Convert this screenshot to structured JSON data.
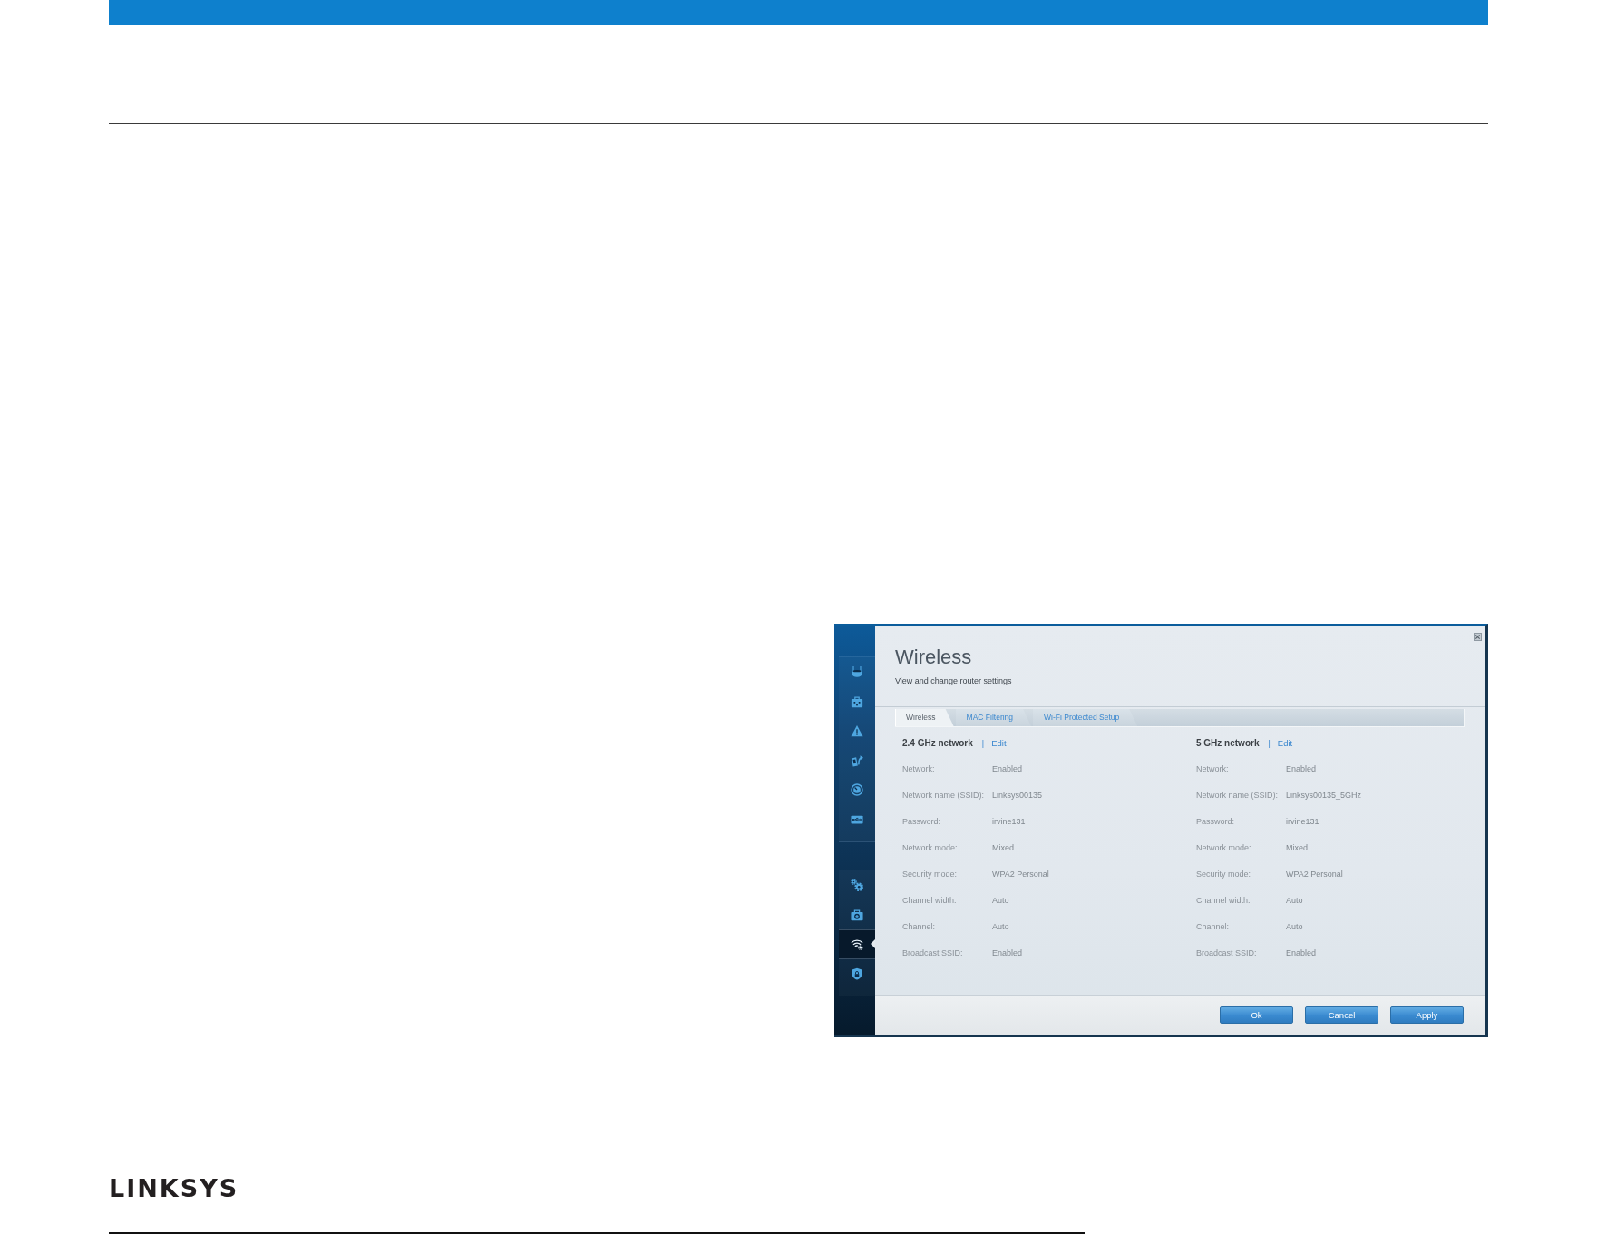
{
  "screenshot": {
    "sidebar": {
      "groups": [
        {
          "items": [
            {
              "kind": "router",
              "selected": false
            },
            {
              "kind": "devices",
              "selected": false
            },
            {
              "kind": "alert",
              "selected": false
            },
            {
              "kind": "parental",
              "selected": false
            },
            {
              "kind": "speed",
              "selected": false
            },
            {
              "kind": "storage",
              "selected": false
            }
          ]
        },
        {
          "items": [
            {
              "kind": "connectivity",
              "selected": false
            },
            {
              "kind": "troubleshooting",
              "selected": false
            },
            {
              "kind": "wireless",
              "selected": true
            },
            {
              "kind": "security",
              "selected": false
            }
          ]
        }
      ]
    },
    "panel": {
      "title": "Wireless",
      "subtitle": "View and change router settings",
      "tabs": [
        {
          "label": "Wireless",
          "selected": true
        },
        {
          "label": "MAC Filtering",
          "selected": false
        },
        {
          "label": "Wi-Fi Protected Setup",
          "selected": false
        }
      ],
      "networks": [
        {
          "heading": "2.4 GHz network",
          "separator": "|",
          "link": "Edit",
          "rows": [
            {
              "label": "Network:",
              "value": "Enabled"
            },
            {
              "label": "Network name (SSID):",
              "value": "Linksys00135"
            },
            {
              "label": "Password:",
              "value": "irvine131"
            },
            {
              "label": "Network mode:",
              "value": "Mixed"
            },
            {
              "label": "Security mode:",
              "value": "WPA2 Personal"
            },
            {
              "label": "Channel width:",
              "value": "Auto"
            },
            {
              "label": "Channel:",
              "value": "Auto"
            },
            {
              "label": "Broadcast SSID:",
              "value": "Enabled"
            }
          ]
        },
        {
          "heading": "5 GHz network",
          "separator": "|",
          "link": "Edit",
          "rows": [
            {
              "label": "Network:",
              "value": "Enabled"
            },
            {
              "label": "Network name (SSID):",
              "value": "Linksys00135_5GHz"
            },
            {
              "label": "Password:",
              "value": "irvine131"
            },
            {
              "label": "Network mode:",
              "value": "Mixed"
            },
            {
              "label": "Security mode:",
              "value": "WPA2 Personal"
            },
            {
              "label": "Channel width:",
              "value": "Auto"
            },
            {
              "label": "Channel:",
              "value": "Auto"
            },
            {
              "label": "Broadcast SSID:",
              "value": "Enabled"
            }
          ]
        }
      ],
      "buttons": [
        "Ok",
        "Cancel",
        "Apply"
      ]
    }
  },
  "footer": {
    "logo": "LINKSYS"
  }
}
